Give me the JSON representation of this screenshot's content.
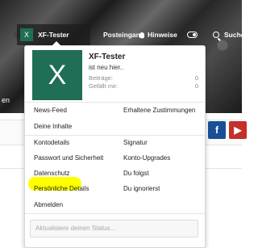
{
  "background": {
    "caption": "en"
  },
  "navbar": {
    "user": {
      "avatar_letter": "X",
      "name": "XF-Tester"
    },
    "inbox_label": "Posteingang",
    "alerts_label": "Hinweise",
    "search_label": "Suche"
  },
  "social": {
    "facebook_letter": "f",
    "youtube_letter": "▶"
  },
  "menu": {
    "avatar_letter": "X",
    "user_name": "XF-Tester",
    "user_title": "ist neu hier..",
    "stats": [
      {
        "label": "Beiträge:",
        "value": "0"
      },
      {
        "label": "Gefällt mir:",
        "value": "0"
      }
    ],
    "left_items": [
      "News-Feed",
      "Deine Inhalte",
      "Kontodetails",
      "Passwort und Sicherheit",
      "Datenschutz",
      "Persönliche Details",
      "Abmelden"
    ],
    "right_items": [
      "Erhaltene Zustimmungen",
      "Signatur",
      "Konto-Upgrades",
      "Du folgst",
      "Du ignorierst"
    ],
    "highlighted_item": "Kontodetails",
    "status_placeholder": "Aktualisiere deinen Status..."
  },
  "colors": {
    "avatar_bg": "#1f6e55",
    "highlight": "#ffff00",
    "facebook": "#1a4f95",
    "youtube": "#c4302b"
  }
}
